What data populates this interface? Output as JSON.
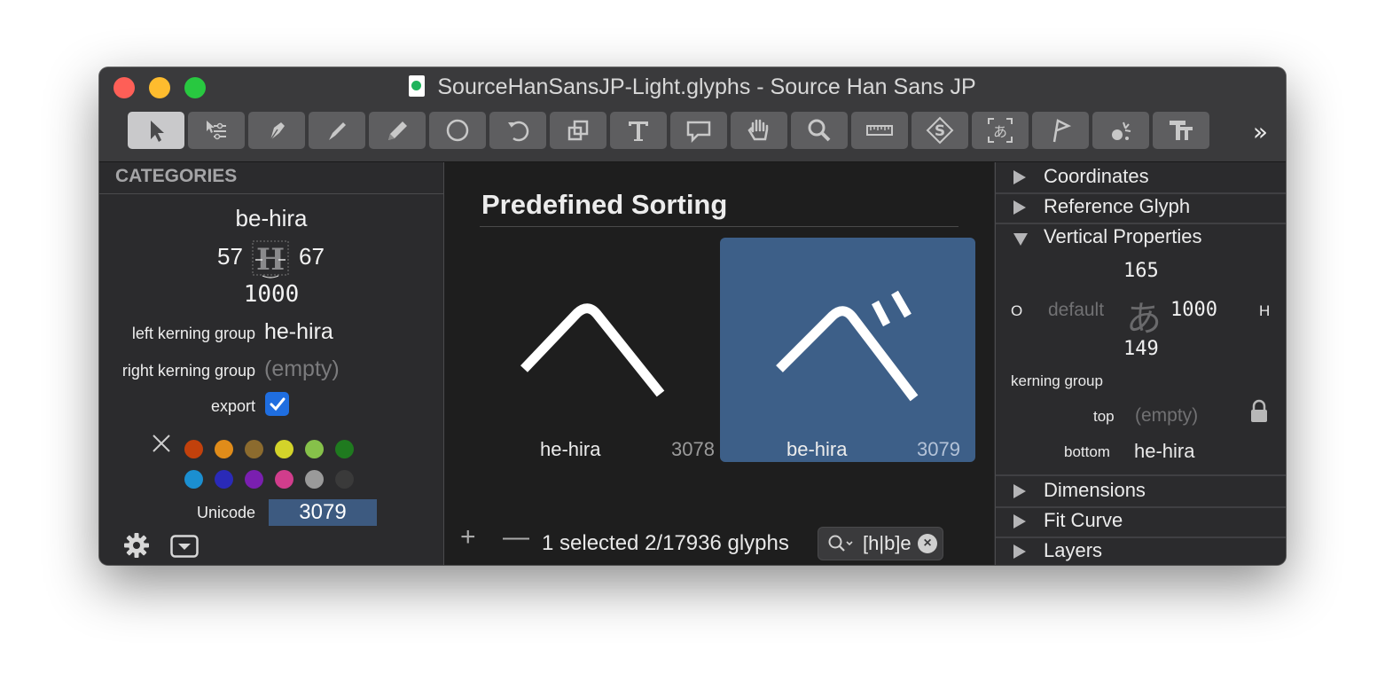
{
  "window": {
    "title": "SourceHanSansJP-Light.glyphs - Source Han Sans JP",
    "toolbar_overflow": "»",
    "tools": [
      "select-tool",
      "select-all-layers-tool",
      "draw-tool",
      "pen-tool",
      "pencil-tool",
      "primitives-tool",
      "rotate-tool",
      "scale-tool",
      "text-tool",
      "annotation-tool",
      "hand-tool",
      "zoom-tool",
      "measurement-tool",
      "stamp-tool",
      "cjk-tool",
      "flag-tool",
      "knife-tool",
      "type-tool"
    ]
  },
  "left_panel": {
    "heading": "CATEGORIES",
    "glyph_name": "be-hira",
    "lsb": "57",
    "rsb": "67",
    "width": "1000",
    "left_kerning_label": "left kerning group",
    "left_kerning_value": "he-hira",
    "right_kerning_label": "right kerning group",
    "right_kerning_value": "(empty)",
    "export_label": "export",
    "unicode_label": "Unicode",
    "unicode_value": "3079",
    "colors": [
      "#c2410c",
      "#e08c1a",
      "#8c6b2e",
      "#d3d32a",
      "#86c14a",
      "#1f7a1f",
      "#1b8fd1",
      "#2a2ab8",
      "#7a1fb0",
      "#d13d8c",
      "#9a9a9a",
      "#3a3a3a"
    ]
  },
  "main": {
    "heading": "Predefined Sorting",
    "glyphs": [
      {
        "name": "he-hira",
        "code": "3078",
        "selected": false
      },
      {
        "name": "be-hira",
        "code": "3079",
        "selected": true
      }
    ],
    "plus_label": "+",
    "minus_label": "—",
    "status": "1 selected 2/17936 glyphs",
    "search_value": "[h|b]e",
    "clear_label": "×"
  },
  "inspector": {
    "sections_top": [
      "Coordinates",
      "Reference Glyph",
      "Vertical Properties"
    ],
    "top_value": "165",
    "origin_label": "O",
    "default_label": "default",
    "sample_char": "あ",
    "height_value": "1000",
    "h_label": "H",
    "bottom_value": "149",
    "kerning_group_label": "kerning group",
    "top_label": "top",
    "top_group_value": "(empty)",
    "bottom_label": "bottom",
    "bottom_group_value": "he-hira",
    "sections_bottom": [
      "Dimensions",
      "Fit Curve",
      "Layers"
    ]
  }
}
